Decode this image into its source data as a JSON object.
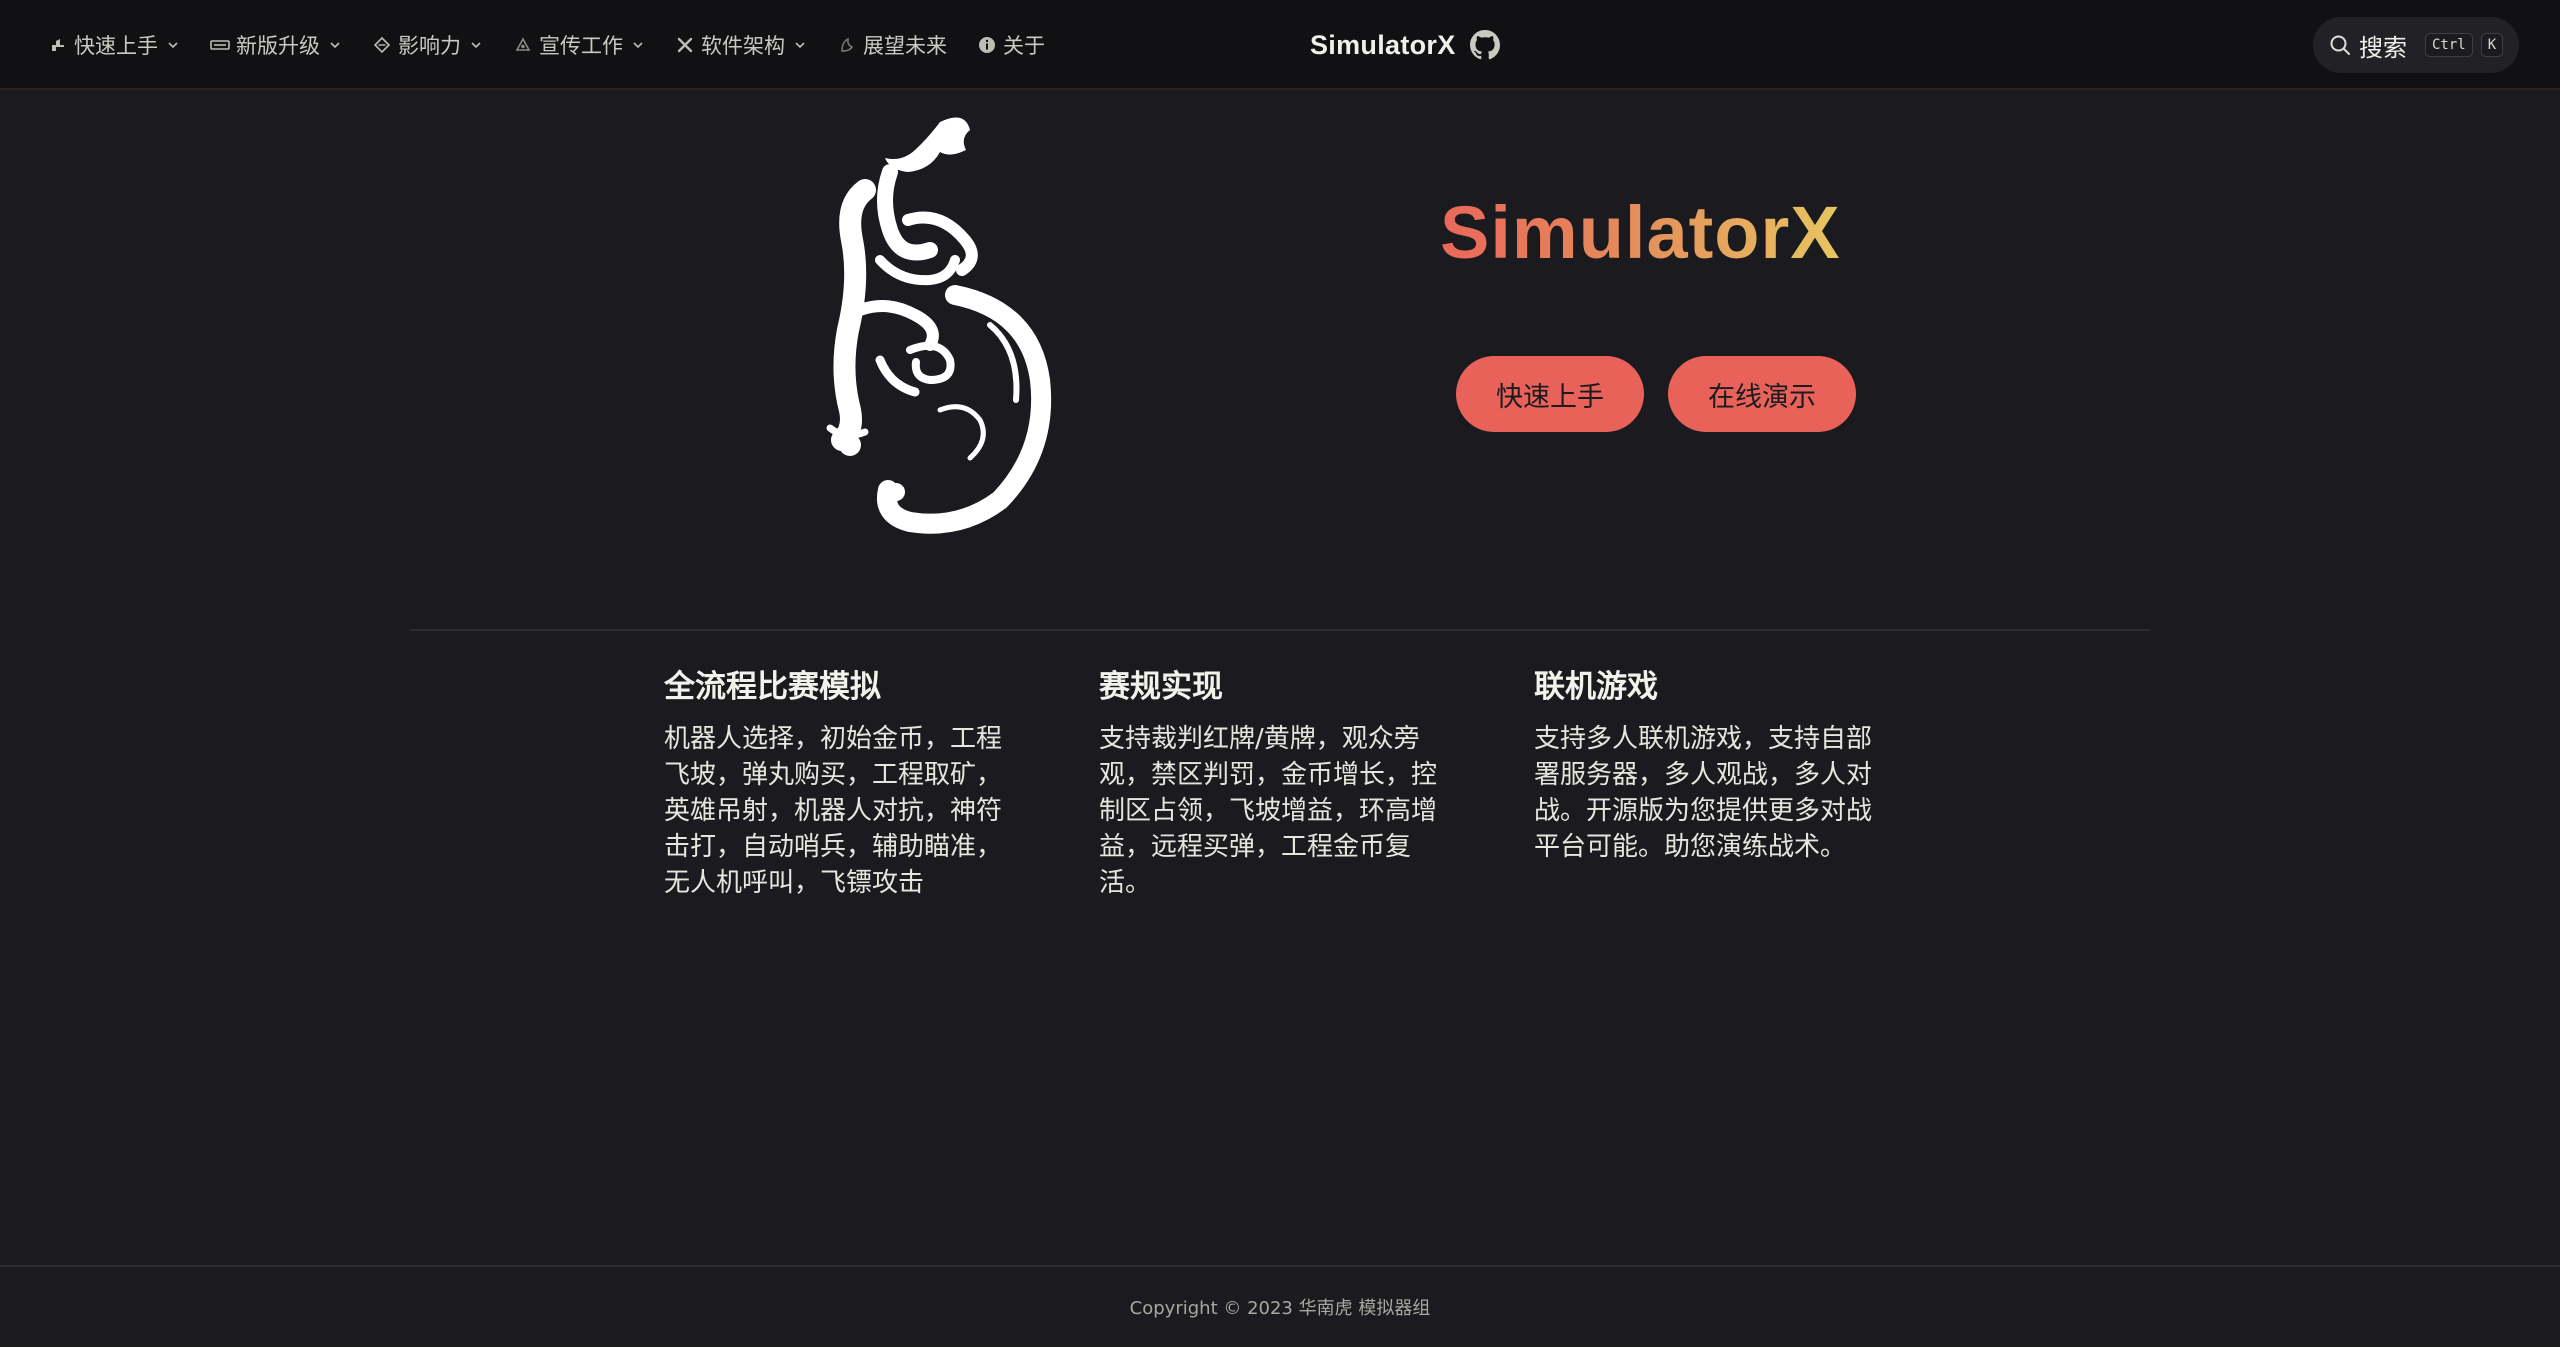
{
  "nav": {
    "items": [
      {
        "label": "快速上手",
        "icon": "rocket-icon",
        "has_dropdown": true
      },
      {
        "label": "新版升级",
        "icon": "upgrade-icon",
        "has_dropdown": true
      },
      {
        "label": "影响力",
        "icon": "diamond-icon",
        "has_dropdown": true
      },
      {
        "label": "宣传工作",
        "icon": "megaphone-icon",
        "has_dropdown": true
      },
      {
        "label": "软件架构",
        "icon": "tools-icon",
        "has_dropdown": true
      },
      {
        "label": "展望未来",
        "icon": "telescope-icon",
        "has_dropdown": false
      },
      {
        "label": "关于",
        "icon": "info-icon",
        "has_dropdown": false
      }
    ],
    "brand": "SimulatorX",
    "github_icon": "github-icon"
  },
  "search": {
    "label": "搜索",
    "key1": "Ctrl",
    "key2": "K",
    "icon": "search-icon"
  },
  "hero": {
    "logo": "tiger-calligraphy-logo",
    "title": "SimulatorX",
    "title_gradient": [
      "#e9675a",
      "#e48a5b",
      "#e7c560"
    ],
    "actions": [
      {
        "label": "快速上手"
      },
      {
        "label": "在线演示"
      }
    ],
    "button_color": "#e8625a"
  },
  "features": [
    {
      "title": "全流程比赛模拟",
      "details": "机器人选择，初始金币，工程飞坡，弹丸购买，工程取矿，英雄吊射，机器人对抗，神符击打，自动哨兵，辅助瞄准，无人机呼叫，飞镖攻击"
    },
    {
      "title": "赛规实现",
      "details": "支持裁判红牌/黄牌，观众旁观，禁区判罚，金币增长，控制区占领，飞坡增益，环高增益，远程买弹，工程金币复活。"
    },
    {
      "title": "联机游戏",
      "details": "支持多人联机游戏，支持自部署服务器，多人观战，多人对战。开源版为您提供更多对战平台可能。助您演练战术。"
    }
  ],
  "footer": {
    "text": "Copyright © 2023 华南虎 模拟器组"
  },
  "colors": {
    "background": "#1b1b1f",
    "navbar": "#111113",
    "accent": "#e8625a"
  }
}
